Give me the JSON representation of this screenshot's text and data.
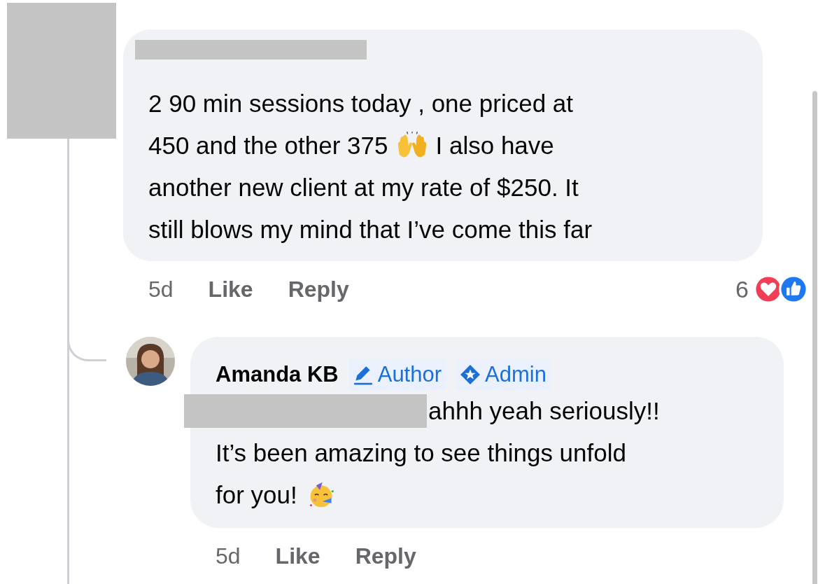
{
  "comments": [
    {
      "avatar": {
        "kind": "redacted"
      },
      "name": {
        "kind": "redacted"
      },
      "lines": [
        [
          {
            "kind": "text",
            "text": "2 90 min sessions today , one priced at"
          }
        ],
        [
          {
            "kind": "text",
            "text": "450 and the other 375"
          },
          {
            "kind": "hands"
          },
          {
            "kind": "text",
            "text": "I also have"
          }
        ],
        [
          {
            "kind": "text",
            "text": "another new client at my rate of $250. It"
          }
        ],
        [
          {
            "kind": "text",
            "text": "still blows my mind that I’ve come this far"
          }
        ]
      ],
      "time": "5d",
      "actions": [
        "Like",
        "Reply"
      ],
      "reaction_count": "6",
      "reactions": [
        {
          "kind": "love"
        },
        {
          "kind": "like"
        }
      ]
    },
    {
      "avatar": {
        "kind": "picture"
      },
      "name": {
        "kind": "text",
        "text": "Amanda KB"
      },
      "badges": [
        {
          "kind": "author",
          "label": "Author"
        },
        {
          "kind": "admin",
          "label": "Admin"
        }
      ],
      "lines": [
        [
          {
            "kind": "redaction"
          },
          {
            "kind": "text",
            "text": "ahhh yeah seriously!!"
          }
        ],
        [
          {
            "kind": "text",
            "text": "It’s been amazing to see things unfold"
          }
        ],
        [
          {
            "kind": "text",
            "text": "for you!"
          },
          {
            "kind": "party"
          }
        ]
      ],
      "time": "5d",
      "actions": [
        "Like",
        "Reply"
      ]
    }
  ]
}
